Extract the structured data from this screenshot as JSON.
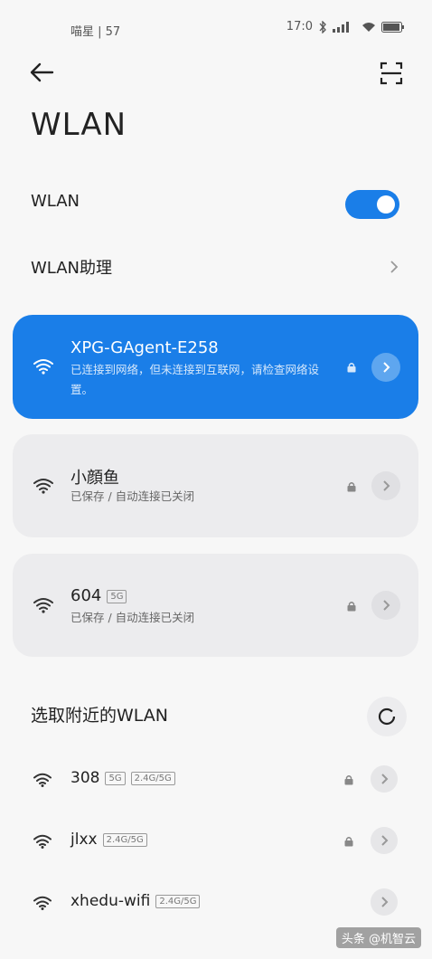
{
  "status_bar": {
    "left_text": "喵星 | 57",
    "right_text": "17:0"
  },
  "header": {
    "title": "WLAN"
  },
  "wlan_toggle": {
    "label": "WLAN",
    "enabled": true
  },
  "assistant": {
    "label": "WLAN助理"
  },
  "saved_networks": [
    {
      "ssid": "XPG-GAgent-E258",
      "status": "已连接到网络，但未连接到互联网，请检查网络设置。",
      "status2": "",
      "locked": true,
      "active": true
    },
    {
      "ssid": "小顔鱼",
      "status": "已保存 / 自动连接已关闭",
      "locked": true,
      "active": false
    },
    {
      "ssid": "604",
      "badge": "5G",
      "status": "已保存 / 自动连接已关闭",
      "locked": true,
      "active": false
    }
  ],
  "nearby": {
    "title": "选取附近的WLAN",
    "networks": [
      {
        "ssid": "308",
        "badges": [
          "5G",
          "2.4G/5G"
        ],
        "locked": true
      },
      {
        "ssid": "jlxx",
        "badges": [
          "2.4G/5G"
        ],
        "locked": true
      },
      {
        "ssid": "xhedu-wifi",
        "badges": [
          "2.4G/5G"
        ],
        "locked": false
      }
    ]
  },
  "watermark": "头条 @机智云",
  "colors": {
    "accent": "#1a7ee8",
    "card": "#ececee",
    "background": "#f7f7f7"
  }
}
